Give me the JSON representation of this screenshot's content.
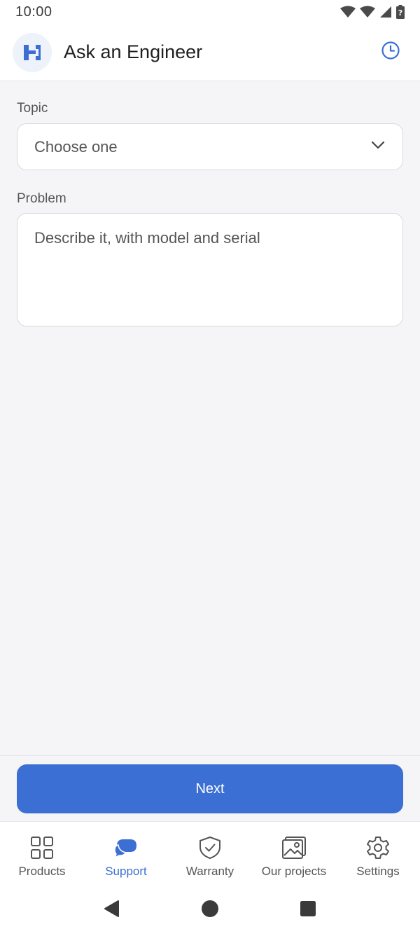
{
  "status_bar": {
    "time": "10:00",
    "icons": [
      "wifi-icon",
      "signal-icon",
      "cellular-icon",
      "battery-unknown-icon"
    ]
  },
  "app_bar": {
    "title": "Ask an Engineer",
    "logo_icon": "brand-logo-icon",
    "history_icon": "history-clock-icon",
    "accent_color": "#3b6fd4"
  },
  "form": {
    "topic": {
      "label": "Topic",
      "value": "Choose one",
      "icon": "chevron-down-icon"
    },
    "problem": {
      "label": "Problem",
      "value": "",
      "placeholder": "Describe it, with model and serial"
    }
  },
  "actions": {
    "next_label": "Next",
    "button_color": "#3b6fd4"
  },
  "bottom_nav": {
    "items": [
      {
        "label": "Products",
        "icon": "grid-icon",
        "active": false
      },
      {
        "label": "Support",
        "icon": "chat-bubbles-icon",
        "active": true
      },
      {
        "label": "Warranty",
        "icon": "shield-check-icon",
        "active": false
      },
      {
        "label": "Our projects",
        "icon": "gallery-icon",
        "active": false
      },
      {
        "label": "Settings",
        "icon": "gear-icon",
        "active": false
      }
    ]
  },
  "system_nav": {
    "icons": [
      "back-icon",
      "home-icon",
      "recents-icon"
    ]
  }
}
